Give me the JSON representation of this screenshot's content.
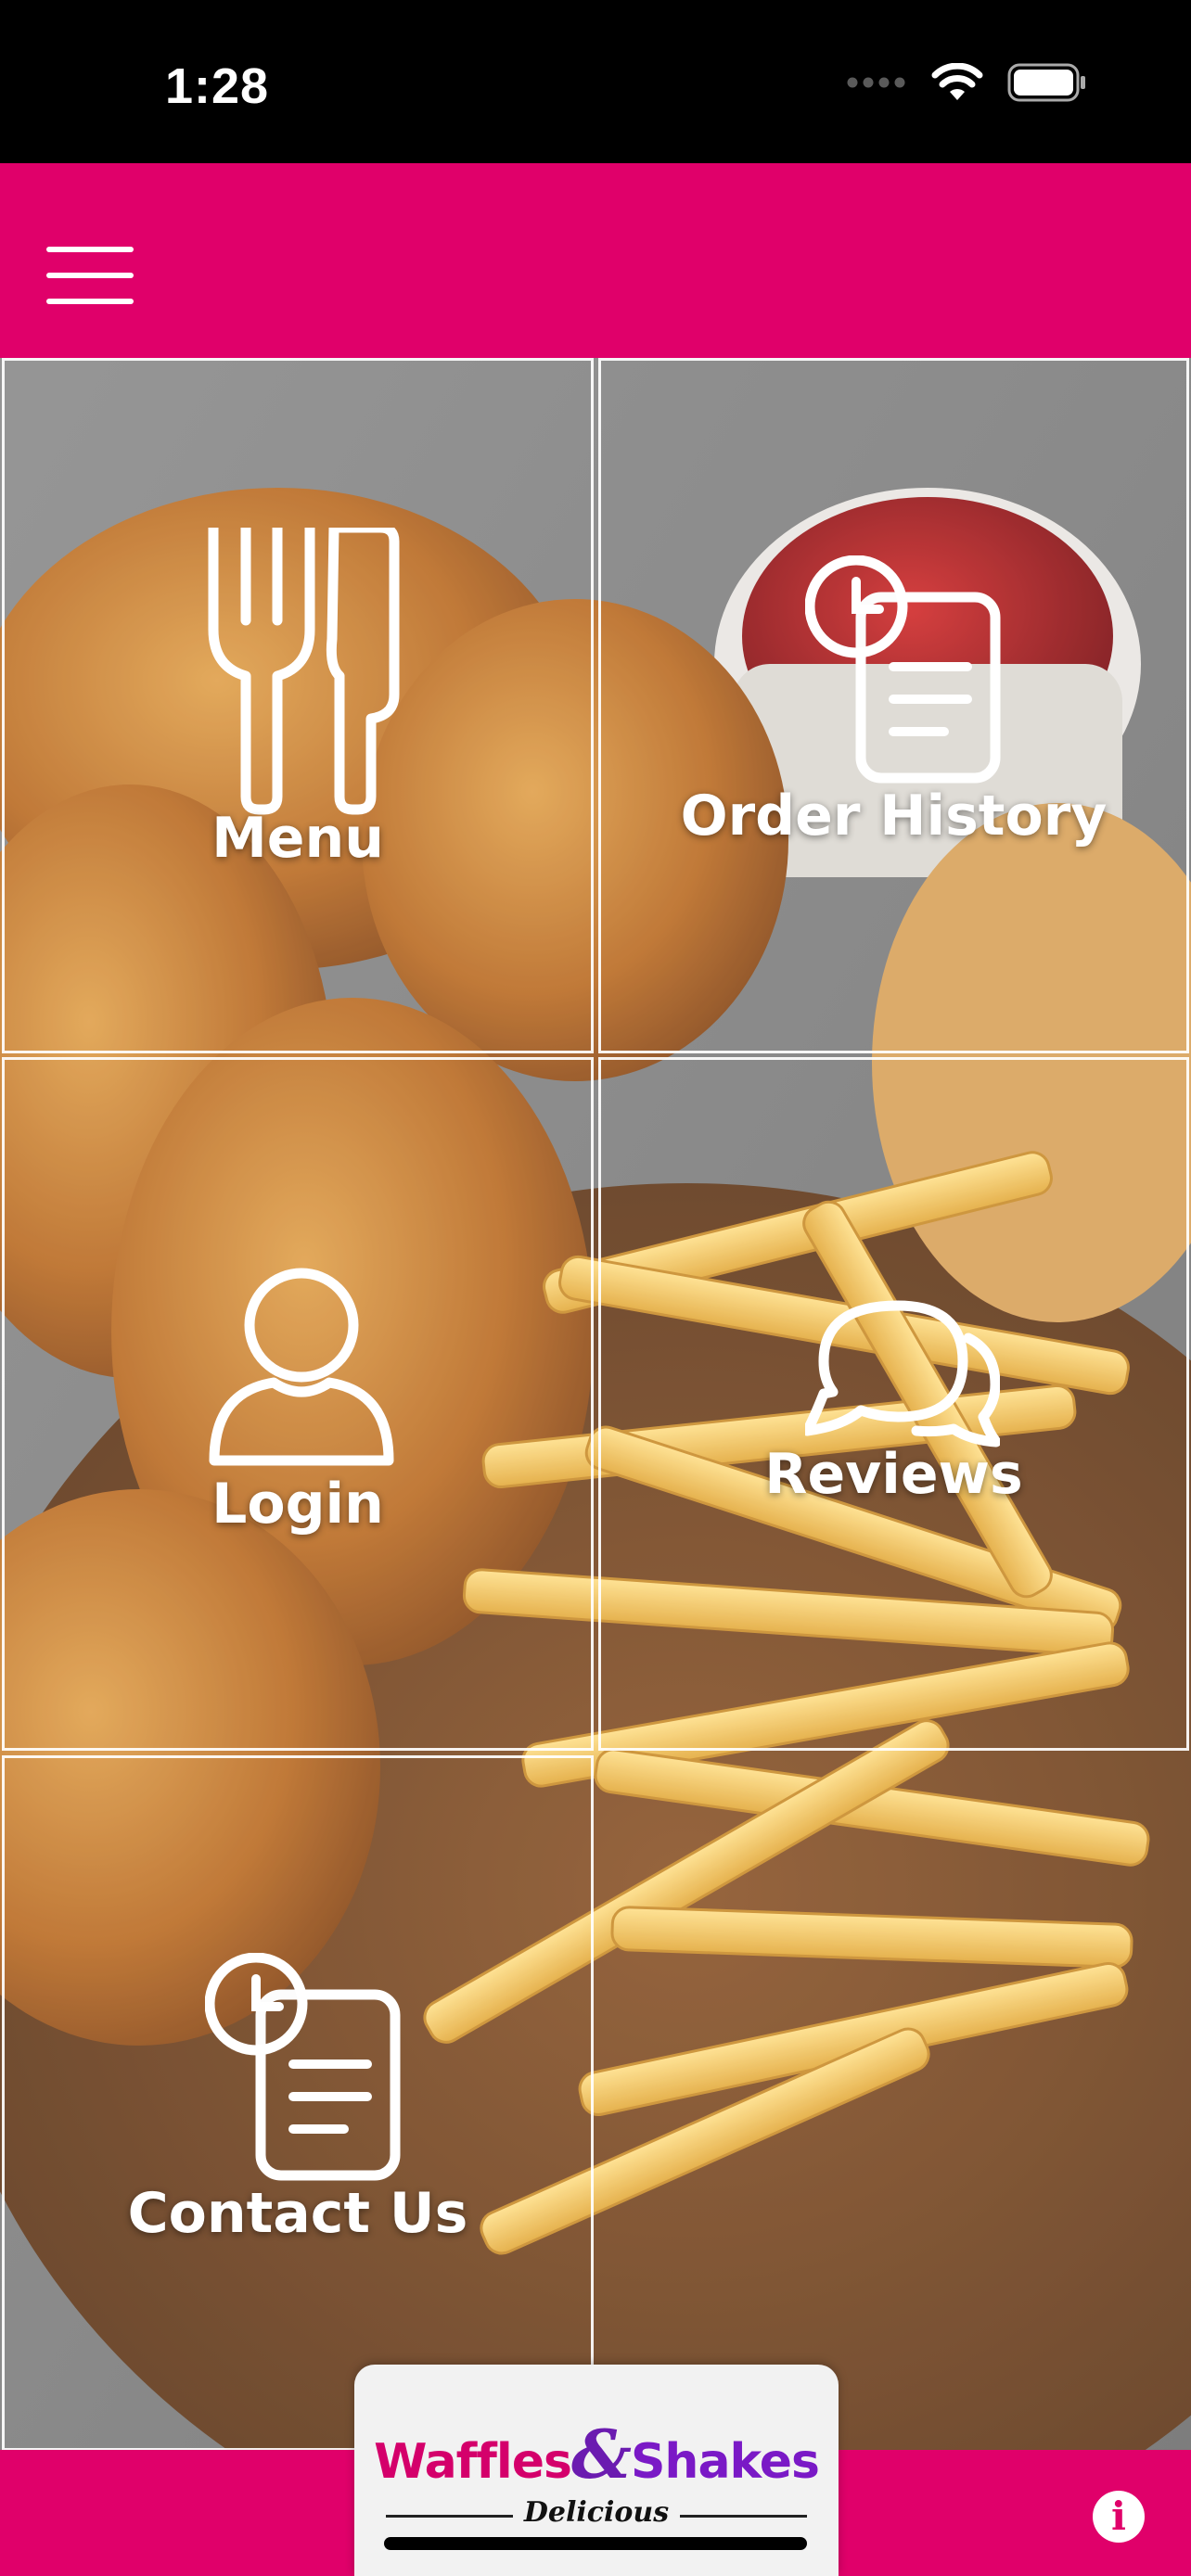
{
  "status_bar": {
    "time": "1:28"
  },
  "header": {
    "menu_icon": "hamburger-icon"
  },
  "tiles": [
    {
      "label": "Menu",
      "icon": "fork-knife-icon"
    },
    {
      "label": "Order History",
      "icon": "clock-document-icon"
    },
    {
      "label": "Login",
      "icon": "user-icon"
    },
    {
      "label": "Reviews",
      "icon": "chat-bubbles-icon"
    },
    {
      "label": "Contact Us",
      "icon": "clock-document-icon"
    }
  ],
  "logo": {
    "word1": "Waffles",
    "ampersand": "&",
    "word2": "Shakes",
    "tagline": "Delicious"
  },
  "footer": {
    "info_icon": "info-icon",
    "info_glyph": "i"
  },
  "colors": {
    "brand": "#e0006a",
    "logo_pink": "#d4006b",
    "logo_purple": "#7a19c6"
  }
}
